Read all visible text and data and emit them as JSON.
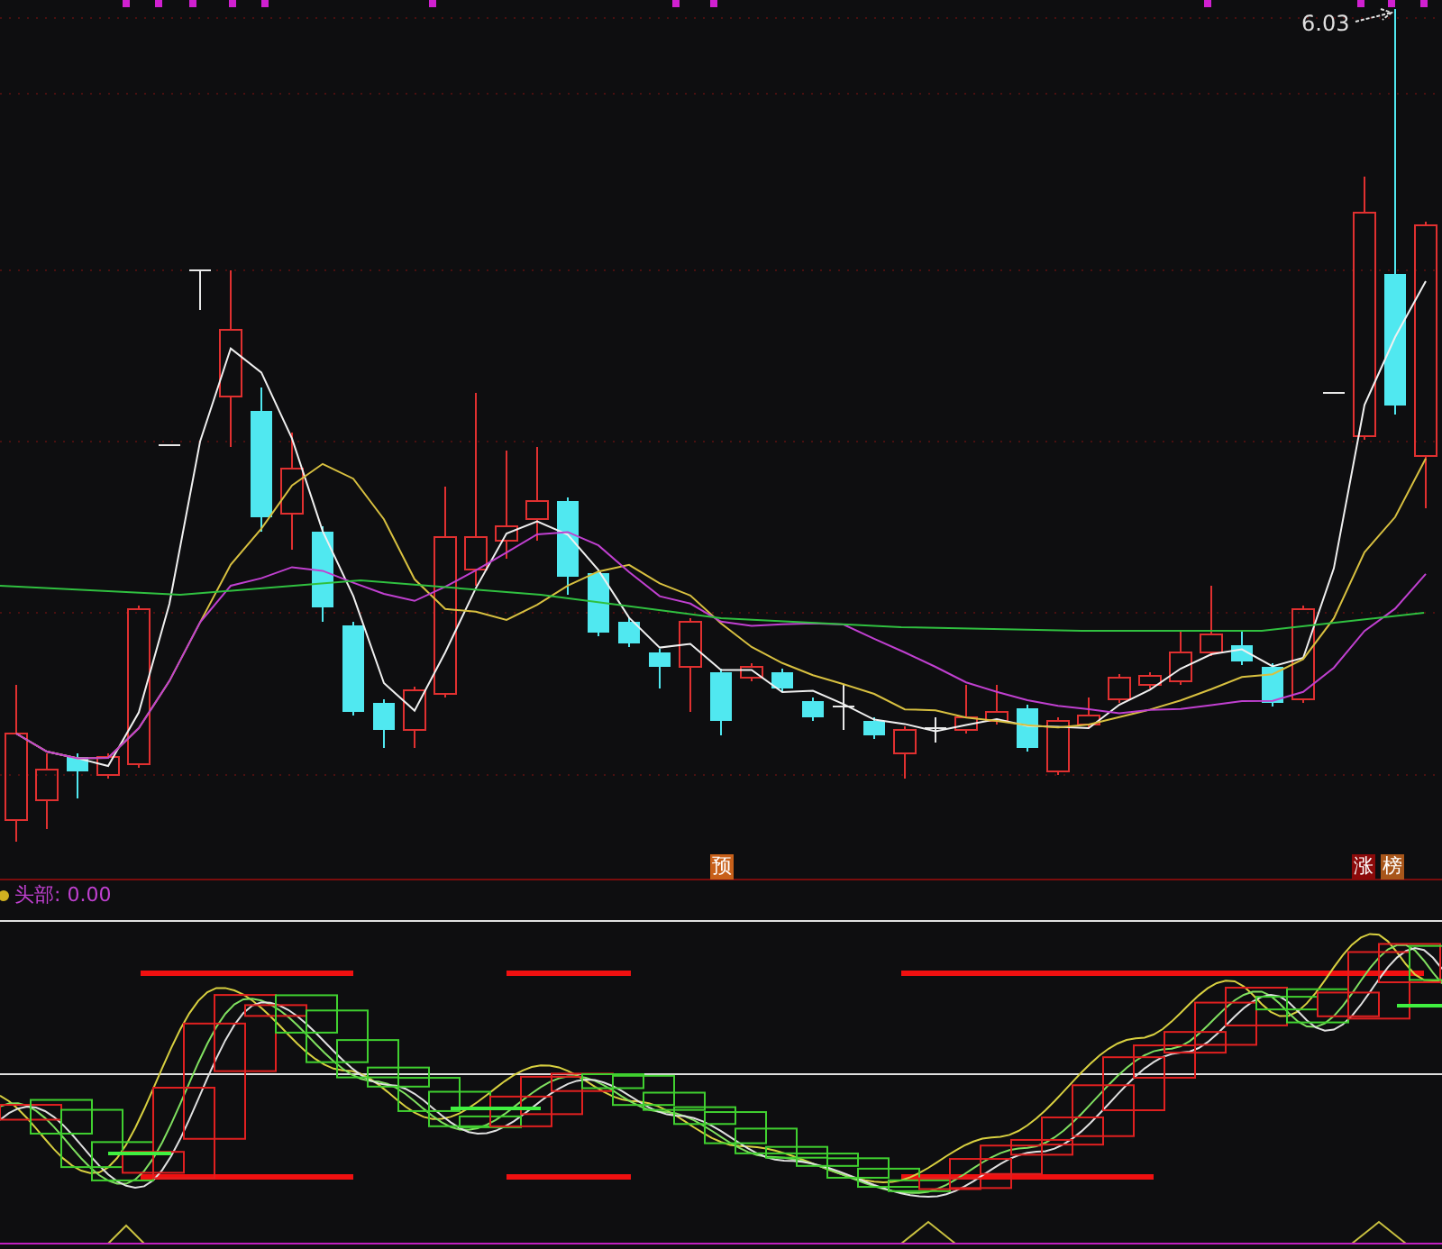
{
  "main_panel": {
    "price_label": "6.03",
    "signals": [
      {
        "text": "预",
        "color": "#c8601a"
      },
      {
        "text": "涨",
        "color": "#8b0a0a"
      },
      {
        "text": "榜",
        "color": "#a8561a"
      }
    ]
  },
  "indicator_panel": {
    "label": "头部: 0.00"
  }
}
